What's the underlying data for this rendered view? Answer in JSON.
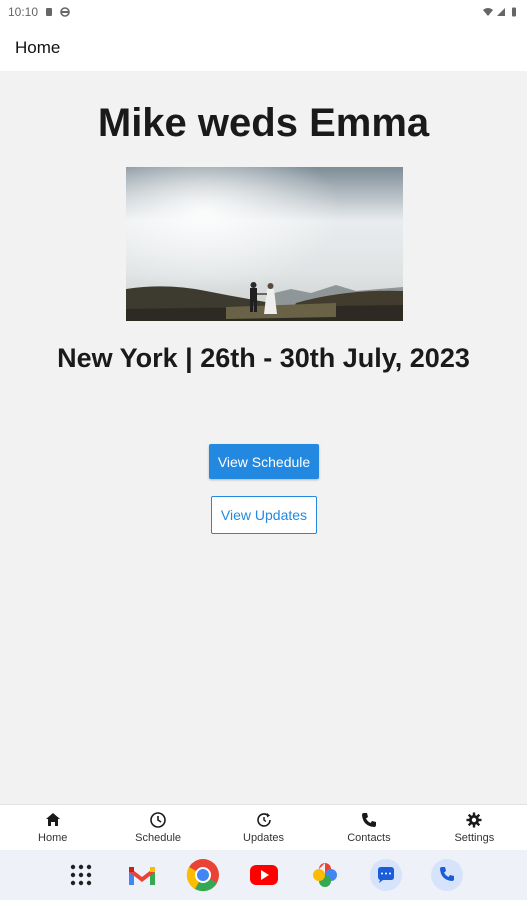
{
  "status_bar": {
    "time": "10:10"
  },
  "app_bar": {
    "title": "Home"
  },
  "main": {
    "title": "Mike weds Emma",
    "subtitle": "New York | 26th - 30th July, 2023",
    "primary_button": "View Schedule",
    "secondary_button": "View Updates"
  },
  "bottom_nav": {
    "items": [
      {
        "label": "Home",
        "icon": "home-icon"
      },
      {
        "label": "Schedule",
        "icon": "clock-icon"
      },
      {
        "label": "Updates",
        "icon": "update-icon"
      },
      {
        "label": "Contacts",
        "icon": "phone-icon"
      },
      {
        "label": "Settings",
        "icon": "gear-icon"
      }
    ]
  },
  "dock": {
    "apps": [
      "app-drawer-icon",
      "gmail-icon",
      "chrome-icon",
      "youtube-icon",
      "photos-icon",
      "messages-icon",
      "phone-icon"
    ]
  },
  "colors": {
    "accent": "#2389e0",
    "background": "#f2f2f2"
  }
}
